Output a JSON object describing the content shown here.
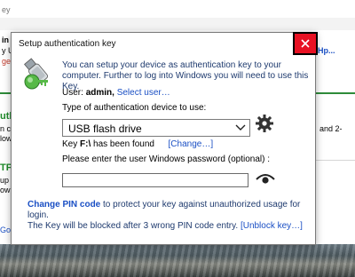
{
  "background": {
    "title_fragment": "ey",
    "fragments": {
      "in": "in",
      "y_u": "y U",
      "ge": "ge",
      "uth": "uth",
      "n_c": "n c",
      "lov": "low",
      "tp": "TP",
      "up": "up C",
      "ov": "ow",
      "go": "Goo",
      "hlp": "Hp...",
      "and2": "and 2-"
    }
  },
  "dialog": {
    "title": "Setup authentication key",
    "close_label": "✕",
    "intro": "You can setup your device as authentication key to your computer. Further to log into Windows you will need to use this Key.",
    "user_label": "User:",
    "user_name": "admin,",
    "select_user_link": "Select user…",
    "device_type_label": "Type of authentication device to use:",
    "device_type_value": "USB flash drive",
    "key_found_prefix": "Key",
    "key_drive": "F:\\",
    "key_found_suffix": "has been found",
    "change_link": "[Change…]",
    "password_label": "Please enter the user Windows password (optional) :",
    "password_value": "",
    "change_pin_link": "Change PIN code",
    "change_pin_text": "to protect your key against unauthorized usage for login.",
    "blocked_text": "The Key will be blocked after 3 wrong PIN code entry.",
    "unblock_link": "[Unblock key…]"
  },
  "colors": {
    "close_button": "#e81123",
    "link": "#1a4fc4",
    "intro_text": "#1e3a6e",
    "background_green": "#1f8a2a"
  },
  "icons": {
    "header": "usb-key-icon",
    "device_settings": "gear-icon",
    "password_toggle": "eye-icon",
    "dropdown": "chevron-down-icon",
    "close": "close-icon"
  }
}
